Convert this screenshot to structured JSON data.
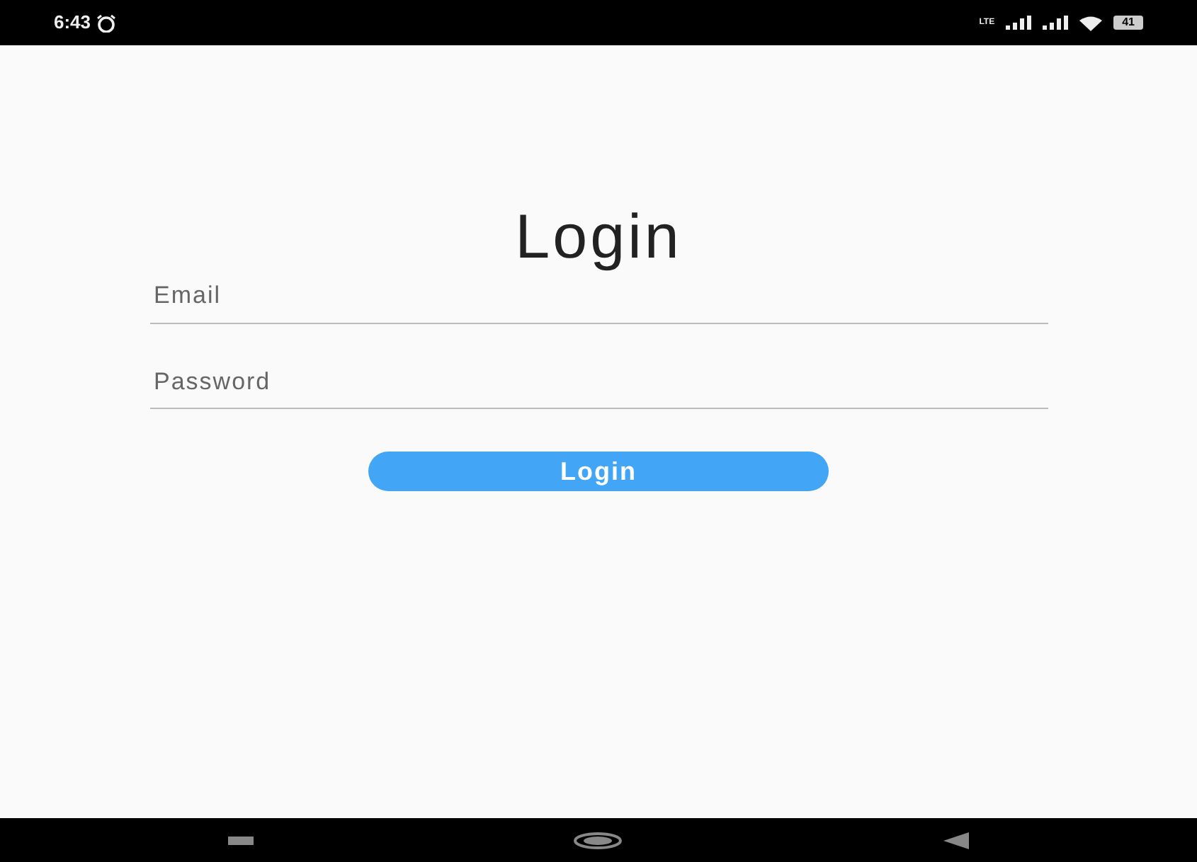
{
  "status_bar": {
    "time": "6:43",
    "network": "LTE",
    "battery": "41"
  },
  "title": "Login",
  "fields": [
    {
      "placeholder": "Email"
    },
    {
      "placeholder": "Password"
    }
  ],
  "button": {
    "label": "Login"
  }
}
